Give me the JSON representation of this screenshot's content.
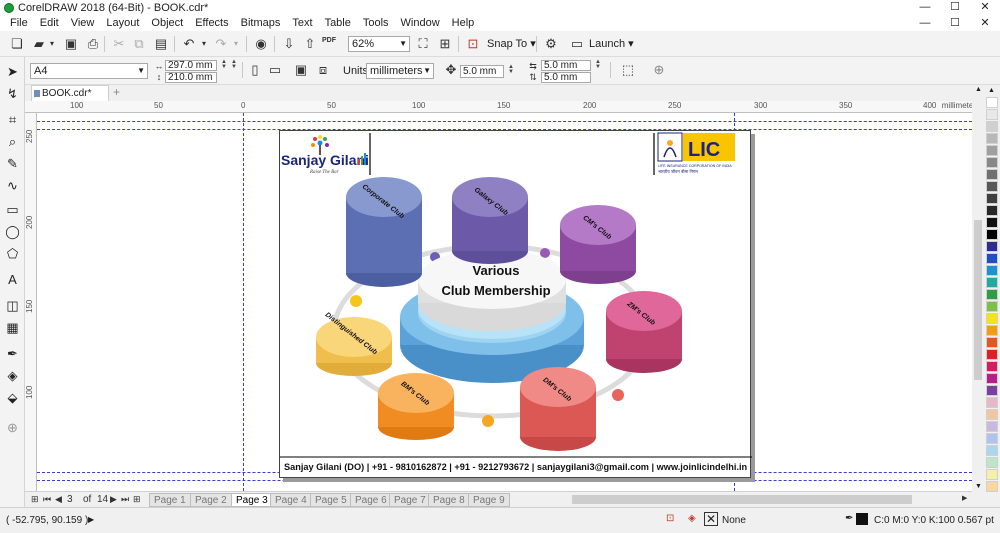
{
  "window": {
    "title": "CorelDRAW 2018 (64-Bit) - BOOK.cdr*",
    "minimize": "—",
    "maximize": "☐",
    "close": "✕"
  },
  "menu": {
    "items": [
      "File",
      "Edit",
      "View",
      "Layout",
      "Object",
      "Effects",
      "Bitmaps",
      "Text",
      "Table",
      "Tools",
      "Window",
      "Help"
    ],
    "doc_controls": [
      "—",
      "☐",
      "✕"
    ]
  },
  "toolbar": {
    "zoom": "62%",
    "snap_to": "Snap To",
    "launch": "Launch",
    "pdf_label": "PDF"
  },
  "propbar": {
    "page_size": "A4",
    "width": "297.0 mm",
    "height": "210.0 mm",
    "units_label": "Units:",
    "units": "millimeters",
    "nudge": "5.0 mm",
    "dup_x": "5.0 mm",
    "dup_y": "5.0 mm"
  },
  "tab": {
    "name": "BOOK.cdr*",
    "add": "+"
  },
  "ruler": {
    "h_labels": [
      "100",
      "50",
      "0",
      "50",
      "100",
      "150",
      "200",
      "250",
      "300",
      "350",
      "400"
    ],
    "units": "millimeters",
    "v_labels": [
      "250",
      "200",
      "150",
      "100"
    ]
  },
  "page_content": {
    "logo_name": "Sanjay Gilani",
    "logo_tagline": "Raise The Bar",
    "lic_logo": "LIC",
    "lic_sub": "LIFE INSURANCE CORPORATION OF INDIA",
    "lic_hindi": "भारतीय जीवन बीमा निगम",
    "center_title_1": "Various",
    "center_title_2": "Club Membership",
    "clubs": [
      "Corporate Club",
      "Galaxy Club",
      "CM's Club",
      "ZM's Club",
      "DM's Club",
      "BM's Club",
      "Distinguished Club"
    ],
    "footer": "Sanjay Gilani (DO)  |  +91 - 9810162872  |  +91 - 9212793672  |  sanjaygilani3@gmail.com  |  www.joinlicindelhi.in"
  },
  "pagenav": {
    "current": "3",
    "of_label": "of",
    "total": "14",
    "pages": [
      "Page 1",
      "Page 2",
      "Page 3",
      "Page 4",
      "Page 5",
      "Page 6",
      "Page 7",
      "Page 8",
      "Page 9"
    ],
    "active_index": 2
  },
  "status": {
    "coords": "( -52.795, 90.159 )",
    "fill_none": "None",
    "outline": "C:0 M:0 Y:0 K:100  0.567 pt"
  },
  "palette": [
    "#ffffff",
    "#e8e8e8",
    "#d0d0d0",
    "#b8b8b8",
    "#a0a0a0",
    "#888888",
    "#707070",
    "#585858",
    "#404040",
    "#282828",
    "#101010",
    "#000000",
    "#2d2d8f",
    "#1e4fc4",
    "#1e90d6",
    "#25a8a0",
    "#2e9d44",
    "#7cc242",
    "#f5e21b",
    "#f39c12",
    "#e8541e",
    "#e31e24",
    "#d81b60",
    "#b51f8a",
    "#7b3fa0",
    "#e7b7c8",
    "#f2c6a0",
    "#c9b8e0",
    "#b0c4ef",
    "#a8d8f0",
    "#bde5c8",
    "#f4f0a8",
    "#f7d6a0"
  ]
}
